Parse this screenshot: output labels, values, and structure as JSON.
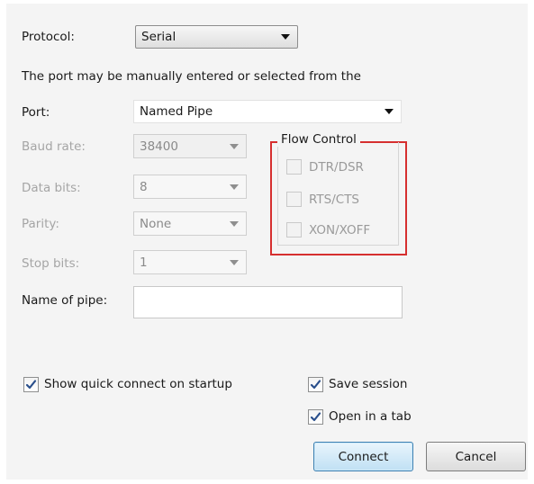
{
  "protocol": {
    "label": "Protocol:",
    "value": "Serial"
  },
  "hint_text": "The port may be manually entered or selected from the",
  "port": {
    "label": "Port:",
    "value": "Named Pipe"
  },
  "baud_rate": {
    "label": "Baud rate:",
    "value": "38400"
  },
  "data_bits": {
    "label": "Data bits:",
    "value": "8"
  },
  "parity": {
    "label": "Parity:",
    "value": "None"
  },
  "stop_bits": {
    "label": "Stop bits:",
    "value": "1"
  },
  "flow_control": {
    "title": "Flow Control",
    "options": [
      {
        "label": "DTR/DSR",
        "checked": false
      },
      {
        "label": "RTS/CTS",
        "checked": false
      },
      {
        "label": "XON/XOFF",
        "checked": false
      }
    ]
  },
  "pipe_name": {
    "label": "Name of pipe:",
    "value": ""
  },
  "options": {
    "show_quick_connect": {
      "label": "Show quick connect on startup",
      "checked": true
    },
    "save_session": {
      "label": "Save session",
      "checked": true
    },
    "open_in_tab": {
      "label": "Open in a tab",
      "checked": true
    }
  },
  "buttons": {
    "connect": "Connect",
    "cancel": "Cancel"
  },
  "colors": {
    "highlight_border": "#d62f2f",
    "check_mark": "#2a4f8c",
    "primary_button": "#c0e0f4"
  },
  "icons": {
    "combo_arrow": "chevron-down-icon",
    "check": "check-icon"
  }
}
